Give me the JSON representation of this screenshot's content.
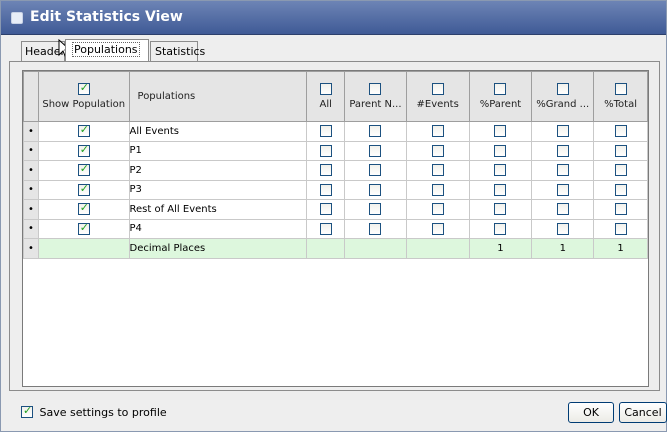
{
  "window": {
    "title": "Edit Statistics View"
  },
  "tabs": [
    {
      "label": "Header"
    },
    {
      "label": "Populations"
    },
    {
      "label": "Statistics"
    }
  ],
  "grid": {
    "header": {
      "show_population": "Show Population",
      "populations": "Populations",
      "stat_columns": [
        "All",
        "Parent N...",
        "#Events",
        "%Parent",
        "%Grand ...",
        "%Total"
      ]
    },
    "rows": [
      {
        "name": "All Events",
        "show": true
      },
      {
        "name": "P1",
        "show": true
      },
      {
        "name": "P2",
        "show": true
      },
      {
        "name": "P3",
        "show": true
      },
      {
        "name": "Rest of All Events",
        "show": true
      },
      {
        "name": "P4",
        "show": true
      }
    ],
    "decimal_row": {
      "label": "Decimal Places",
      "values": [
        "",
        "",
        "",
        "1",
        "1",
        "1"
      ]
    },
    "decimal_row_color": "#DDF7DD"
  },
  "footer": {
    "save_label": "Save settings to profile",
    "save_checked": true,
    "ok_label": "OK",
    "cancel_label": "Cancel"
  },
  "colors": {
    "titlebar": "#4F6AA6",
    "checkmark": "#21A121"
  }
}
